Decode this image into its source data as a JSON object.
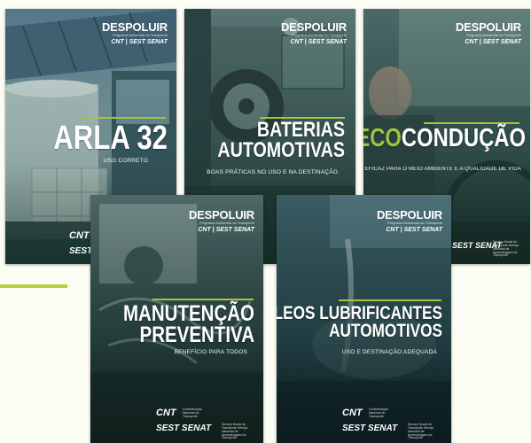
{
  "brand": {
    "name": "DESPOLUIR",
    "tagline": "Programa Ambiental do Transporte",
    "cnt": "CNT",
    "sest_senat": "SEST SENAT",
    "combined": "CNT | SEST SENAT",
    "cnt_small": "Confederação Nacional do Transporte",
    "sest_small": "Serviço Social do Transporte Serviço Nacional de Aprendizagem do Transporte"
  },
  "covers": [
    {
      "title_lines": [
        "ARLA 32"
      ],
      "subtitle": "USO CORRETO"
    },
    {
      "title_lines": [
        "BATERIAS",
        "AUTOMOTIVAS"
      ],
      "subtitle": "BOAS PRÁTICAS NO USO E NA DESTINAÇÃO."
    },
    {
      "title_prefix": "ECO",
      "title_main": "CONDUÇÃO",
      "subtitle": "EFICAZ PARA O MEIO AMBIENTE E A QUALIDADE DE VIDA"
    },
    {
      "title_lines": [
        "MANUTENÇÃO",
        "PREVENTIVA"
      ],
      "subtitle": "BENEFÍCIO PARA TODOS"
    },
    {
      "title_lines": [
        "ÓLEOS LUBRIFICANTES",
        "AUTOMOTIVOS"
      ],
      "subtitle": "USO E DESTINAÇÃO ADEQUADA"
    }
  ],
  "colors": {
    "accent_green": "#a6c63a",
    "background": "#fbfcf4"
  }
}
